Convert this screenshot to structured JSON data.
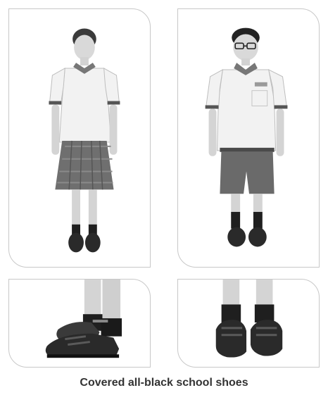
{
  "caption": "Covered all-black school shoes",
  "colors": {
    "skin": "#d6d6d6",
    "shirt": "#f2f2f2",
    "shirt_trim": "#555555",
    "skirt": "#6f6f6f",
    "shorts": "#6a6a6a",
    "shoe": "#2a2a2a",
    "sock": "#1f1f1f",
    "hair": "#2b2b2b",
    "panel_border": "#c8c8c8"
  }
}
